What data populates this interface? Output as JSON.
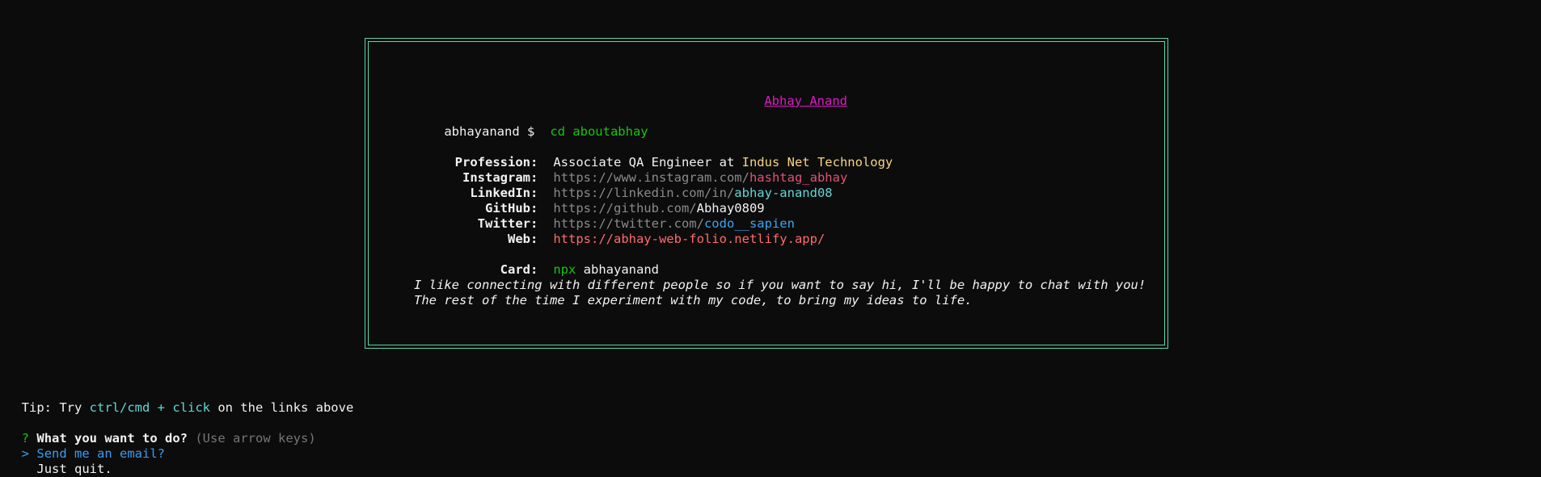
{
  "card": {
    "name": "Abhay Anand",
    "prompt_user": "abhayanand $",
    "prompt_cmd": "cd aboutabhay",
    "profession": {
      "label": "Profession:",
      "prefix": "Associate QA Engineer at ",
      "company": "Indus Net Technology"
    },
    "instagram": {
      "label": "Instagram:",
      "base": "https://www.instagram.com/",
      "handle": "hashtag_abhay"
    },
    "linkedin": {
      "label": "LinkedIn:",
      "base": "https://linkedin.com/in/",
      "handle": "abhay-anand08"
    },
    "github": {
      "label": "GitHub:",
      "base": "https://github.com/",
      "handle": "Abhay0809"
    },
    "twitter": {
      "label": "Twitter:",
      "base": "https://twitter.com/",
      "handle": "codo__sapien"
    },
    "web": {
      "label": "Web:",
      "url": "https://abhay-web-folio.netlify.app/"
    },
    "card_cmd": {
      "label": "Card:",
      "npx": "npx",
      "pkg": "abhayanand"
    },
    "bio_line1": "I like connecting with different people so if you want to say hi, I'll be happy to chat with you!",
    "bio_line2": "The rest of the time I experiment with my code, to bring my ideas to life."
  },
  "tip": {
    "prefix": "Tip: Try ",
    "keys": "ctrl/cmd + click",
    "suffix": " on the links above"
  },
  "question": {
    "mark": "?",
    "text": "What you want to do?",
    "hint": "(Use arrow keys)"
  },
  "options": [
    {
      "pointer": ">",
      "label": "Send me an email?"
    },
    {
      "pointer": " ",
      "label": "Just quit."
    }
  ],
  "colors": {
    "border": "#58d6ad",
    "background": "#0c0c0c"
  }
}
